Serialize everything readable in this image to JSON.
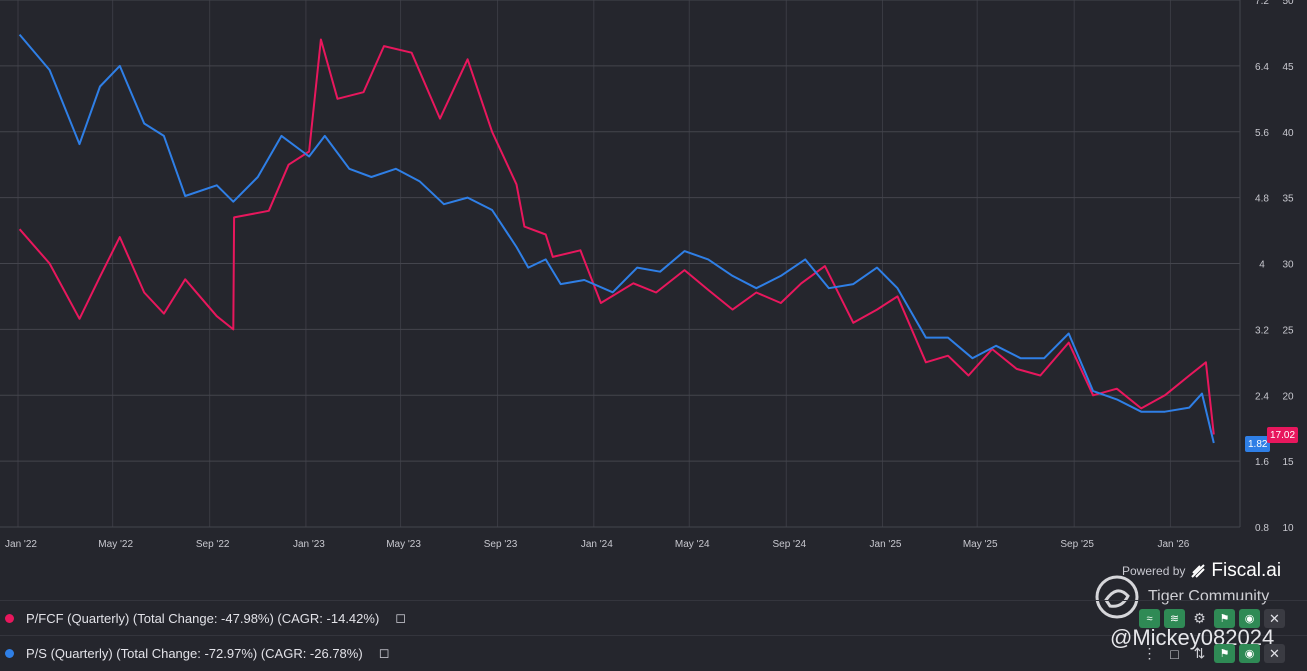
{
  "chart_data": {
    "type": "line",
    "x": [
      "Jan '22",
      "May '22",
      "Sep '22",
      "Jan '23",
      "May '23",
      "Sep '23",
      "Jan '24",
      "May '24",
      "Sep '24",
      "Jan '25",
      "May '25",
      "Sep '25",
      "Jan '26"
    ],
    "x_tick_labels": [
      "Jan '22",
      "May '22",
      "Sep '22",
      "Jan '23",
      "May '23",
      "Sep '23",
      "Jan '24",
      "May '24",
      "Sep '24",
      "Jan '25",
      "May '25",
      "Sep '25",
      "Jan '26"
    ],
    "y_left_ticks": [
      "0.8",
      "1.6",
      "2.4",
      "3.2",
      "4",
      "4.8",
      "5.6",
      "6.4",
      "7.2"
    ],
    "y_right_ticks": [
      "10",
      "15",
      "20",
      "25",
      "30",
      "35",
      "40",
      "45",
      "50"
    ],
    "y_left_range": [
      0.8,
      7.2
    ],
    "y_right_range": [
      10,
      50
    ],
    "grid": true,
    "series": [
      {
        "name": "P/FCF (Quarterly) (Total Change: -47.98%) (CAGR: -14.42%)",
        "color": "#e8175d",
        "axis": "right",
        "last_label": "17.02",
        "points": [
          [
            "2022-01-03",
            32.6
          ],
          [
            "2022-02-10",
            30.0
          ],
          [
            "2022-03-20",
            25.8
          ],
          [
            "2022-04-15",
            29.0
          ],
          [
            "2022-05-10",
            32.0
          ],
          [
            "2022-06-10",
            27.8
          ],
          [
            "2022-07-05",
            26.2
          ],
          [
            "2022-08-01",
            28.8
          ],
          [
            "2022-09-10",
            26.0
          ],
          [
            "2022-10-01",
            25.0
          ],
          [
            "2022-10-02",
            33.5
          ],
          [
            "2022-11-15",
            34.0
          ],
          [
            "2022-12-10",
            37.5
          ],
          [
            "2023-01-05",
            38.5
          ],
          [
            "2023-01-20",
            47.0
          ],
          [
            "2023-02-10",
            42.5
          ],
          [
            "2023-03-15",
            43.0
          ],
          [
            "2023-04-10",
            46.5
          ],
          [
            "2023-05-15",
            46.0
          ],
          [
            "2023-06-20",
            41.0
          ],
          [
            "2023-07-25",
            45.5
          ],
          [
            "2023-08-25",
            40.0
          ],
          [
            "2023-09-25",
            36.0
          ],
          [
            "2023-10-05",
            32.8
          ],
          [
            "2023-11-01",
            32.2
          ],
          [
            "2023-11-10",
            30.5
          ],
          [
            "2023-12-15",
            31.0
          ],
          [
            "2024-01-10",
            27.0
          ],
          [
            "2024-02-20",
            28.5
          ],
          [
            "2024-03-20",
            27.8
          ],
          [
            "2024-04-25",
            29.5
          ],
          [
            "2024-05-25",
            28.0
          ],
          [
            "2024-06-25",
            26.5
          ],
          [
            "2024-07-25",
            27.8
          ],
          [
            "2024-08-25",
            27.0
          ],
          [
            "2024-09-20",
            28.5
          ],
          [
            "2024-10-20",
            29.8
          ],
          [
            "2024-11-25",
            25.5
          ],
          [
            "2024-12-25",
            26.5
          ],
          [
            "2025-01-20",
            27.5
          ],
          [
            "2025-02-25",
            22.5
          ],
          [
            "2025-03-25",
            23.0
          ],
          [
            "2025-04-20",
            21.5
          ],
          [
            "2025-05-20",
            23.5
          ],
          [
            "2025-06-20",
            22.0
          ],
          [
            "2025-07-20",
            21.5
          ],
          [
            "2025-08-25",
            24.0
          ],
          [
            "2025-09-25",
            20.0
          ],
          [
            "2025-10-25",
            20.5
          ],
          [
            "2025-11-25",
            19.0
          ],
          [
            "2025-12-25",
            20.0
          ],
          [
            "2026-01-25",
            21.5
          ],
          [
            "2026-02-15",
            22.5
          ],
          [
            "2026-02-25",
            17.02
          ]
        ]
      },
      {
        "name": "P/S (Quarterly) (Total Change: -72.97%) (CAGR: -26.78%)",
        "color": "#2f7fe6",
        "axis": "left",
        "last_label": "1.82",
        "points": [
          [
            "2022-01-03",
            6.78
          ],
          [
            "2022-02-10",
            6.35
          ],
          [
            "2022-03-20",
            5.45
          ],
          [
            "2022-04-15",
            6.15
          ],
          [
            "2022-05-10",
            6.4
          ],
          [
            "2022-06-10",
            5.7
          ],
          [
            "2022-07-05",
            5.55
          ],
          [
            "2022-08-01",
            4.82
          ],
          [
            "2022-09-10",
            4.95
          ],
          [
            "2022-10-01",
            4.75
          ],
          [
            "2022-11-01",
            5.05
          ],
          [
            "2022-12-01",
            5.55
          ],
          [
            "2023-01-05",
            5.3
          ],
          [
            "2023-01-25",
            5.55
          ],
          [
            "2023-02-25",
            5.15
          ],
          [
            "2023-03-25",
            5.05
          ],
          [
            "2023-04-25",
            5.15
          ],
          [
            "2023-05-25",
            5.0
          ],
          [
            "2023-06-25",
            4.72
          ],
          [
            "2023-07-25",
            4.8
          ],
          [
            "2023-08-25",
            4.65
          ],
          [
            "2023-09-25",
            4.2
          ],
          [
            "2023-10-10",
            3.95
          ],
          [
            "2023-11-01",
            4.05
          ],
          [
            "2023-11-20",
            3.75
          ],
          [
            "2023-12-20",
            3.8
          ],
          [
            "2024-01-25",
            3.65
          ],
          [
            "2024-02-25",
            3.95
          ],
          [
            "2024-03-25",
            3.9
          ],
          [
            "2024-04-25",
            4.15
          ],
          [
            "2024-05-25",
            4.05
          ],
          [
            "2024-06-25",
            3.85
          ],
          [
            "2024-07-25",
            3.7
          ],
          [
            "2024-08-25",
            3.85
          ],
          [
            "2024-09-25",
            4.05
          ],
          [
            "2024-10-25",
            3.7
          ],
          [
            "2024-11-25",
            3.75
          ],
          [
            "2024-12-25",
            3.95
          ],
          [
            "2025-01-20",
            3.7
          ],
          [
            "2025-02-25",
            3.1
          ],
          [
            "2025-03-25",
            3.1
          ],
          [
            "2025-04-25",
            2.85
          ],
          [
            "2025-05-25",
            3.0
          ],
          [
            "2025-06-25",
            2.85
          ],
          [
            "2025-07-25",
            2.85
          ],
          [
            "2025-08-25",
            3.15
          ],
          [
            "2025-09-25",
            2.45
          ],
          [
            "2025-10-25",
            2.35
          ],
          [
            "2025-11-25",
            2.2
          ],
          [
            "2025-12-25",
            2.2
          ],
          [
            "2026-01-25",
            2.25
          ],
          [
            "2026-02-10",
            2.42
          ],
          [
            "2026-02-25",
            1.82
          ]
        ]
      }
    ]
  },
  "legend": [
    {
      "label": "P/FCF (Quarterly) (Total Change: -47.98%) (CAGR: -14.42%)",
      "color": "#e8175d",
      "bookmark_icon": "bookmark-icon"
    },
    {
      "label": "P/S (Quarterly) (Total Change: -72.97%) (CAGR: -26.78%)",
      "color": "#2f7fe6",
      "bookmark_icon": "bookmark-icon"
    }
  ],
  "branding": {
    "powered_by": "Powered by",
    "brand": "Fiscal.ai",
    "watermark_title": "Tiger Community",
    "watermark_handle": "@Mickey082024"
  },
  "toolbars": {
    "row1": [
      "line-chart-icon",
      "trend-icon",
      "gear-icon",
      "tag-icon",
      "eye-icon",
      "close-icon"
    ],
    "row2": [
      "line-chart-icon",
      "trend-icon",
      "sort-icon",
      "tag-icon",
      "eye-icon",
      "close-icon"
    ]
  }
}
